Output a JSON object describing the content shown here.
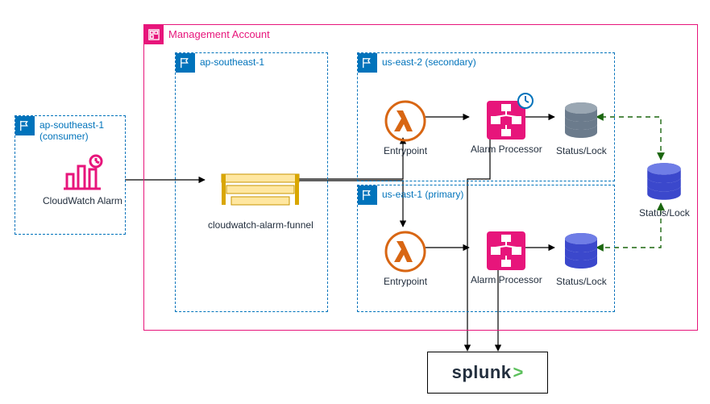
{
  "consumer": {
    "title": "ap-southeast-1 (consumer)",
    "cloudwatch_alarm": "CloudWatch Alarm"
  },
  "mgmt": {
    "title": "Management Account",
    "primary_region": {
      "title": "ap-southeast-1",
      "sns_topic": "cloudwatch-alarm-funnel"
    },
    "secondary_a": {
      "title": "us-east-2 (secondary)",
      "entrypoint": "Entrypoint",
      "processor": "Alarm Processor",
      "lock": "Status/Lock"
    },
    "secondary_b": {
      "title": "us-east-1 (primary)",
      "entrypoint": "Entrypoint",
      "processor": "Alarm Processor",
      "lock": "Status/Lock"
    },
    "global_lock": "Status/Lock"
  },
  "splunk": {
    "wordmark": "splunk",
    "caret": ">"
  },
  "colors": {
    "region_border": "#0073bb",
    "region_text": "#0073bb",
    "mgmt": "#e7157b",
    "lambda": "#d86613",
    "sfn": "#e7157b",
    "db": "#3b48cc",
    "sns": "#b0084d",
    "queue": "#d9a600",
    "splunk_green": "#5cc05c",
    "replication": "#1b660f"
  }
}
